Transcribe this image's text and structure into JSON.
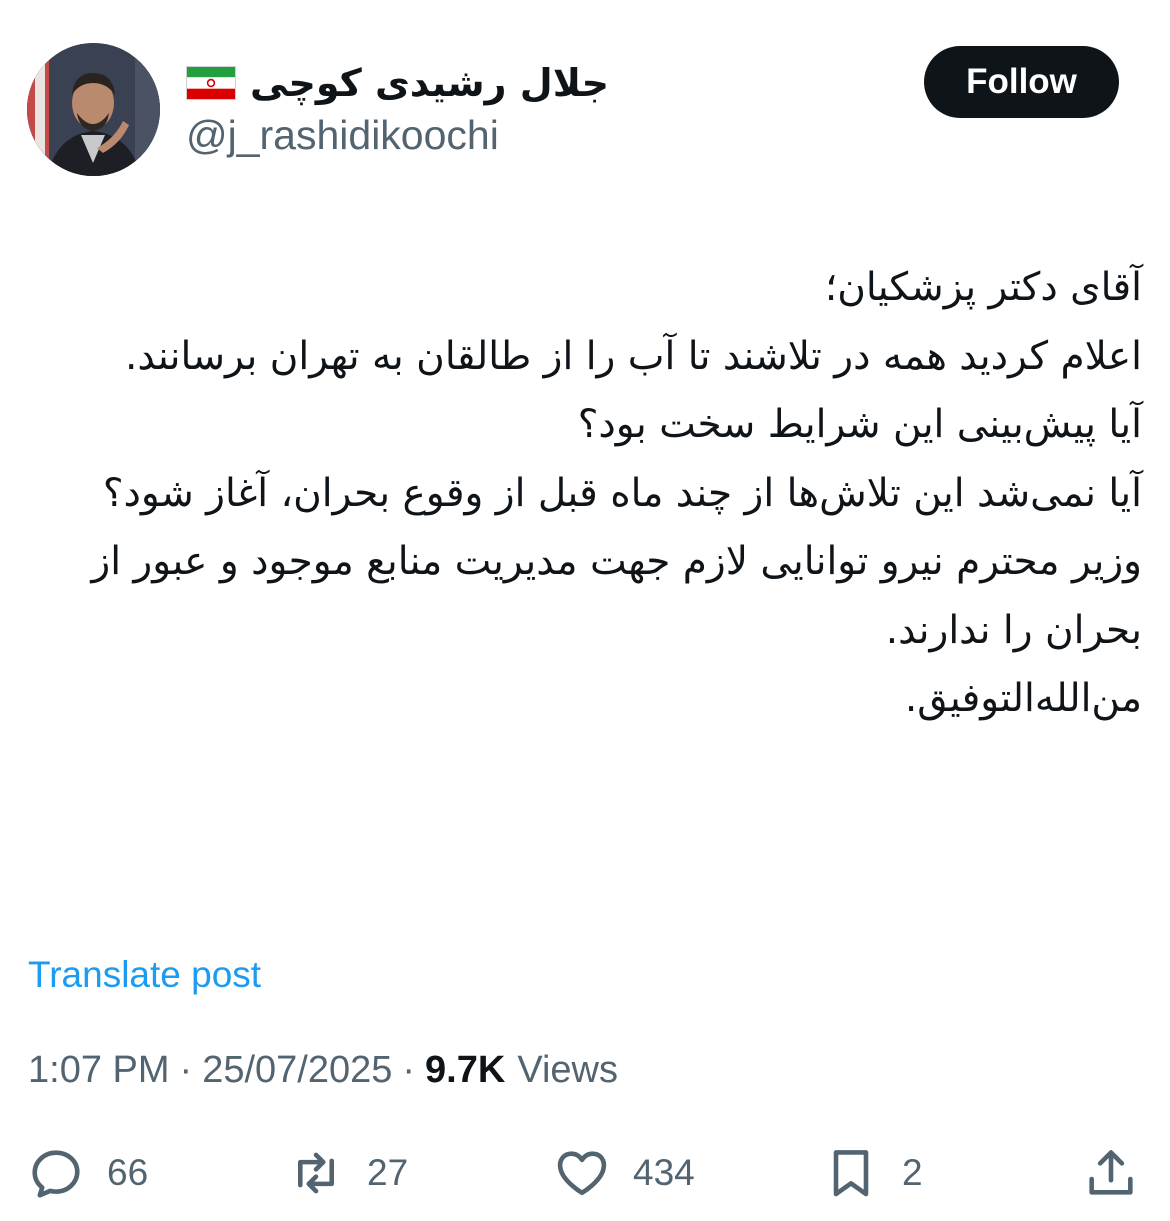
{
  "author": {
    "display_name": "جلال رشیدی کوچی",
    "flag_icon": "iran-flag-icon",
    "handle": "@j_rashidikoochi",
    "avatar_icon": "profile-photo"
  },
  "follow_label": "Follow",
  "post": {
    "lines": [
      "آقای دکتر پزشکیان؛",
      "اعلام کردید همه در تلاشند تا آب را از طالقان به تهران برسانند.",
      "آیا پیش‌بینی این شرایط سخت بود؟",
      "آیا نمی‌شد این تلاش‌ها از چند ماه قبل از وقوع بحران، آغاز شود؟",
      "وزیر محترم نیرو توانایی لازم جهت مدیریت منابع موجود و عبور از بحران را ندارند.",
      "من‌الله‌التوفیق."
    ]
  },
  "translate_label": "Translate post",
  "meta": {
    "time": "1:07 PM",
    "separator": "·",
    "date": "25/07/2025",
    "views_count": "9.7K",
    "views_label": "Views"
  },
  "actions": {
    "reply": {
      "icon": "reply-icon",
      "count": "66"
    },
    "repost": {
      "icon": "repost-icon",
      "count": "27"
    },
    "like": {
      "icon": "heart-icon",
      "count": "434"
    },
    "bookmark": {
      "icon": "bookmark-icon",
      "count": "2"
    },
    "share": {
      "icon": "share-icon"
    }
  },
  "colors": {
    "text": "#0f1419",
    "secondary": "#536471",
    "link": "#1d9bf0",
    "button": "#0f1419"
  }
}
